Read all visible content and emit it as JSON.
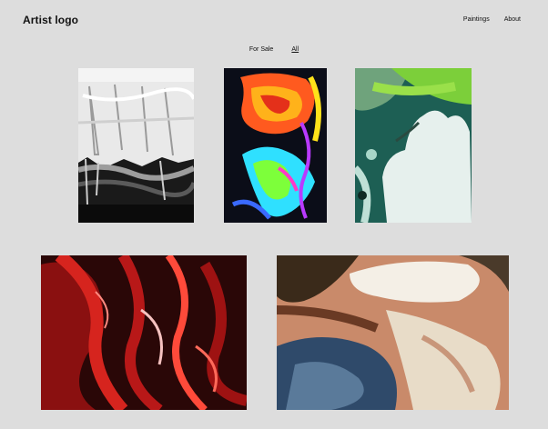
{
  "header": {
    "logo": "Artist logo",
    "nav": [
      "Paintings",
      "About"
    ]
  },
  "filters": {
    "items": [
      "For Sale",
      "All"
    ],
    "active": "All"
  },
  "gallery": {
    "artworks": [
      {
        "palette": [
          "#f0efef",
          "#222222",
          "#7a7a7a"
        ]
      },
      {
        "palette": [
          "#0b0d18",
          "#ff5a1f",
          "#2fe0ff",
          "#7dff3a"
        ]
      },
      {
        "palette": [
          "#1e6a5a",
          "#7ccf3a",
          "#e8f2ef"
        ]
      },
      {
        "palette": [
          "#2a0707",
          "#c51a1a",
          "#ff4a3a"
        ]
      },
      {
        "palette": [
          "#c98a6a",
          "#f4efe6",
          "#2f4a6a",
          "#6a3a24"
        ]
      }
    ]
  }
}
